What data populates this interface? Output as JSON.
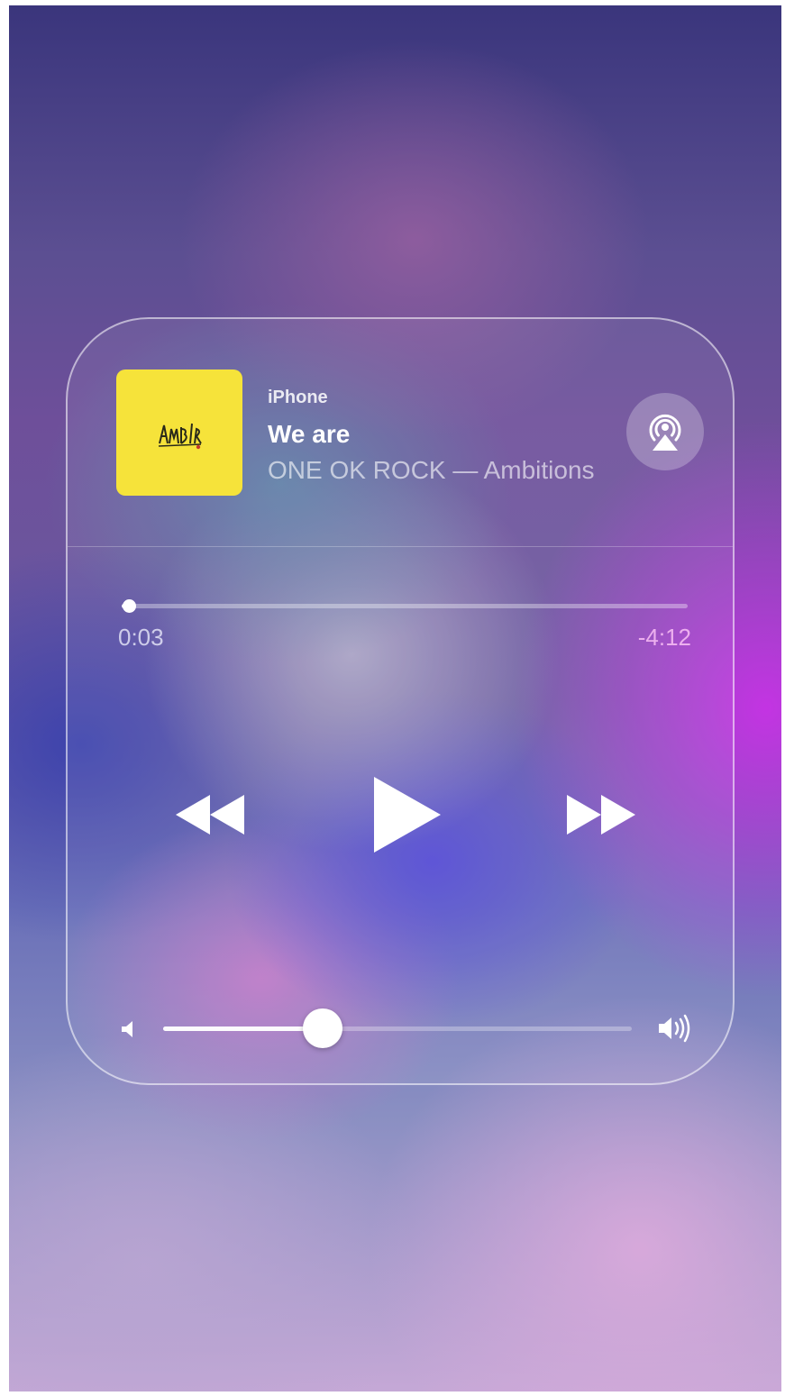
{
  "now_playing": {
    "source": "iPhone",
    "title": "We are",
    "artist_album": "ONE OK ROCK — Ambitions",
    "album_art_text": "Ambitions",
    "album_art_color": "#f6e33a"
  },
  "playback": {
    "elapsed": "0:03",
    "remaining": "-4:12",
    "progress_fraction": 0.012,
    "is_playing": false
  },
  "controls": {
    "rewind_icon": "rewind-icon",
    "play_icon": "play-icon",
    "forward_icon": "fast-forward-icon",
    "airplay_icon": "airplay-icon"
  },
  "volume": {
    "level_fraction": 0.34,
    "low_icon": "volume-low-icon",
    "high_icon": "volume-high-icon"
  }
}
